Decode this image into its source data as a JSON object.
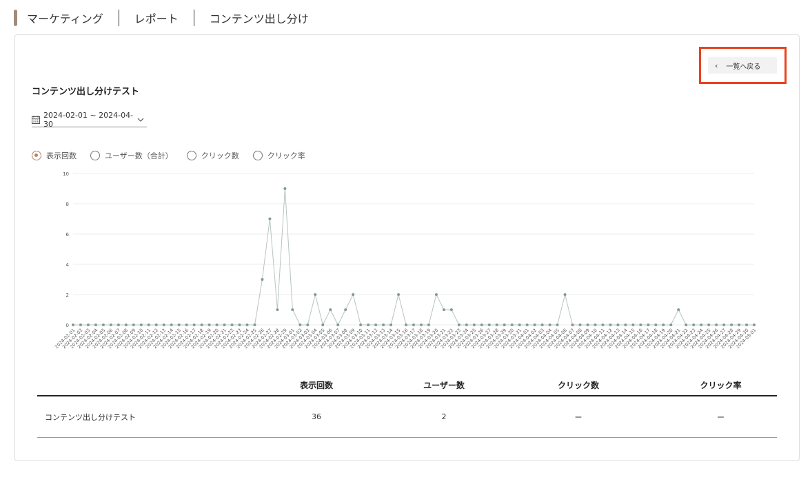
{
  "breadcrumb": {
    "items": [
      "マーケティング",
      "レポート",
      "コンテンツ出し分け"
    ]
  },
  "back_button": {
    "label": "一覧へ戻る"
  },
  "page_title": "コンテンツ出し分けテスト",
  "date_range": {
    "value": "2024-02-01 ~ 2024-04-30"
  },
  "metric_options": [
    {
      "label": "表示回数",
      "checked": true
    },
    {
      "label": "ユーザー数（合計）",
      "checked": false
    },
    {
      "label": "クリック数",
      "checked": false
    },
    {
      "label": "クリック率",
      "checked": false
    }
  ],
  "colors": {
    "accent": "#a08c78",
    "radio_selected": "#b9825c",
    "highlight": "#e8431f",
    "line": "#b8c4bd",
    "point": "#7f9c90"
  },
  "chart_data": {
    "type": "line",
    "ylim": [
      0,
      10
    ],
    "yticks": [
      0,
      2,
      4,
      6,
      8,
      10
    ],
    "grid": true,
    "series": [
      {
        "values": [
          0,
          0,
          0,
          0,
          0,
          0,
          0,
          0,
          0,
          0,
          0,
          0,
          0,
          0,
          0,
          0,
          0,
          0,
          0,
          0,
          0,
          0,
          0,
          0,
          0,
          3,
          7,
          1,
          9,
          1,
          0,
          0,
          2,
          0,
          1,
          0,
          1,
          2,
          0,
          0,
          0,
          0,
          0,
          2,
          0,
          0,
          0,
          0,
          2,
          1,
          1,
          0,
          0,
          0,
          0,
          0,
          0,
          0,
          0,
          0,
          0,
          0,
          0,
          0,
          0,
          2,
          0,
          0,
          0,
          0,
          0,
          0,
          0,
          0,
          0,
          0,
          0,
          0,
          0,
          0,
          1,
          0,
          0,
          0,
          0,
          0,
          0,
          0,
          0,
          0,
          0
        ]
      }
    ]
  },
  "table": {
    "headers": [
      "",
      "表示回数",
      "ユーザー数",
      "クリック数",
      "クリック率"
    ],
    "rows": [
      [
        "コンテンツ出し分けテスト",
        "36",
        "2",
        "ー",
        "ー"
      ]
    ]
  }
}
